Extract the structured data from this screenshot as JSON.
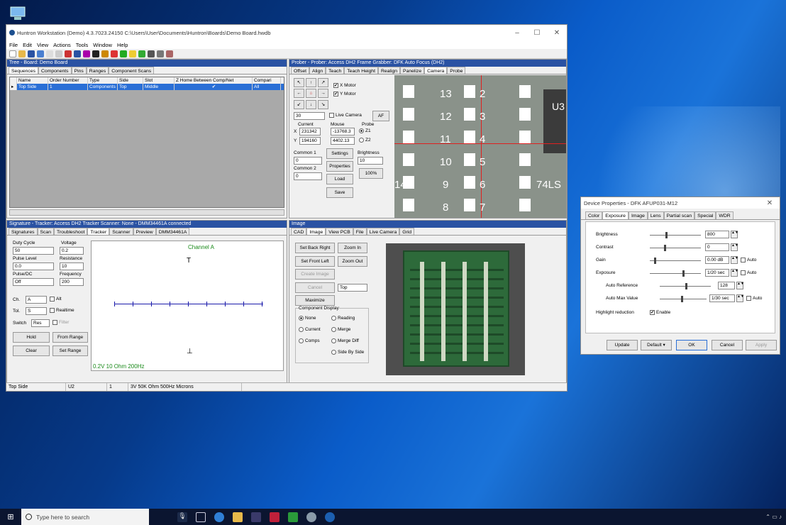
{
  "main_window": {
    "title": "Huntron Workstation (Demo) 4.3.7023.24150  C:\\Users\\User\\Documents\\Huntron\\Boards\\Demo Board.hwdb",
    "menu": [
      "File",
      "Edit",
      "View",
      "Actions",
      "Tools",
      "Window",
      "Help"
    ]
  },
  "tree": {
    "header": "Tree - Board: Demo Board",
    "tabs": [
      "Sequences",
      "Components",
      "Pins",
      "Ranges",
      "Component Scans"
    ],
    "columns": [
      "Name",
      "Order Number",
      "Type",
      "Side",
      "Slot",
      "Z Home Between Comp/Net",
      "Compari"
    ],
    "row": [
      "Top Side",
      "1",
      "Components",
      "Top",
      "Middle",
      "✔",
      "All"
    ]
  },
  "prober": {
    "header": "Prober - Prober: Access DH2 Frame Grabber: DFK Auto Focus (DH2)",
    "tabs": [
      "Offset",
      "Align",
      "Teach",
      "Teach Height",
      "Realign",
      "Panelize",
      "Camera",
      "Probe"
    ],
    "x_motor": "X Motor",
    "y_motor": "Y Motor",
    "step": "30",
    "live_camera": "Live Camera",
    "af": "AF",
    "current": "Current",
    "cur_x": "231342",
    "cur_y": "194160",
    "mouse": "Mouse",
    "mouse_x": "-13768.3",
    "mouse_y": "4402.13",
    "probe": "Probe",
    "z1": "Z1",
    "z2": "Z2",
    "common1": "Common 1",
    "common1_val": "0",
    "common2": "Common 2",
    "common2_val": "0",
    "settings": "Settings",
    "properties": "Properties",
    "load": "Load",
    "save": "Save",
    "brightness": "Brightness",
    "brightness_val": "10",
    "percent": "100%",
    "pads": [
      "13",
      "12",
      "11",
      "10",
      "9",
      "8",
      "2",
      "3",
      "4",
      "5",
      "6",
      "7"
    ],
    "u3": "U3",
    "ls": "74LS",
    "label_14": "14"
  },
  "signature": {
    "header": "Signature - Tracker: Access DH2 Tracker  Scanner: None - DMM34461A connected",
    "tabs": [
      "Signatures",
      "Scan",
      "Troubleshoot",
      "Tracker",
      "Scanner",
      "Preview",
      "DMM34461A"
    ],
    "duty_cycle": "Duty Cycle",
    "duty_val": "50",
    "voltage": "Voltage",
    "voltage_val": "0.2",
    "pulse_level": "Pulse Level",
    "pulse_val": "0.0",
    "resistance": "Resistance",
    "resistance_val": "10",
    "pulse_dc": "Pulse/DC",
    "pulse_dc_val": "Off",
    "frequency": "Frequency",
    "frequency_val": "200",
    "ch": "Ch.",
    "ch_val": "A",
    "alt": "Alt",
    "tol": "Tol.",
    "tol_val": "S",
    "realtime": "Realtime",
    "switch": "Switch",
    "switch_val": "Res",
    "filter": "Filter",
    "hold": "Hold",
    "from_range": "From Range",
    "clear": "Clear",
    "set_range": "Set Range",
    "channel": "Channel A",
    "footer": "0.2V 10 Ohm 200Hz",
    "top_marker": "T",
    "bottom_marker": "⊥"
  },
  "image": {
    "header": "Image",
    "tabs": [
      "CAD",
      "Image",
      "View PCB",
      "File",
      "Live Camera",
      "Grid"
    ],
    "set_back_right": "Set Back Right",
    "zoom_in": "Zoom In",
    "set_front_left": "Set Front Left",
    "zoom_out": "Zoom Out",
    "create_image": "Create Image",
    "cancel": "Cancel",
    "side": "Top",
    "maximize": "Maximize",
    "comp_display": "Component Display",
    "none": "None",
    "reading": "Reading",
    "current": "Current",
    "merge": "Merge",
    "comps": "Comps",
    "merge_diff": "Merge Diff",
    "side_by_side": "Side By Side"
  },
  "status": [
    "Top Side",
    "U2",
    "1",
    "3V 50K Ohm 500Hz  Microns"
  ],
  "dialog": {
    "title": "Device Properties - DFK AFUP031-M12",
    "tabs": [
      "Color",
      "Exposure",
      "Image",
      "Lens",
      "Partial scan",
      "Special",
      "WDR"
    ],
    "rows": [
      {
        "label": "Brightness",
        "value": "800",
        "auto": false
      },
      {
        "label": "Contrast",
        "value": "0",
        "auto": false
      },
      {
        "label": "Gain",
        "value": "0.00 dB",
        "auto": true
      },
      {
        "label": "Exposure",
        "value": "1/20 sec",
        "auto": true
      },
      {
        "label": "Auto Reference",
        "value": "128",
        "auto": false
      },
      {
        "label": "Auto Max Value",
        "value": "1/30 sec",
        "auto": true
      }
    ],
    "auto": "Auto",
    "highlight": "Highlight reduction",
    "enable": "Enable",
    "update": "Update",
    "default": "Default ▾",
    "ok": "OK",
    "cancel": "Cancel",
    "apply": "Apply"
  },
  "taskbar": {
    "search_placeholder": "Type here to search"
  }
}
